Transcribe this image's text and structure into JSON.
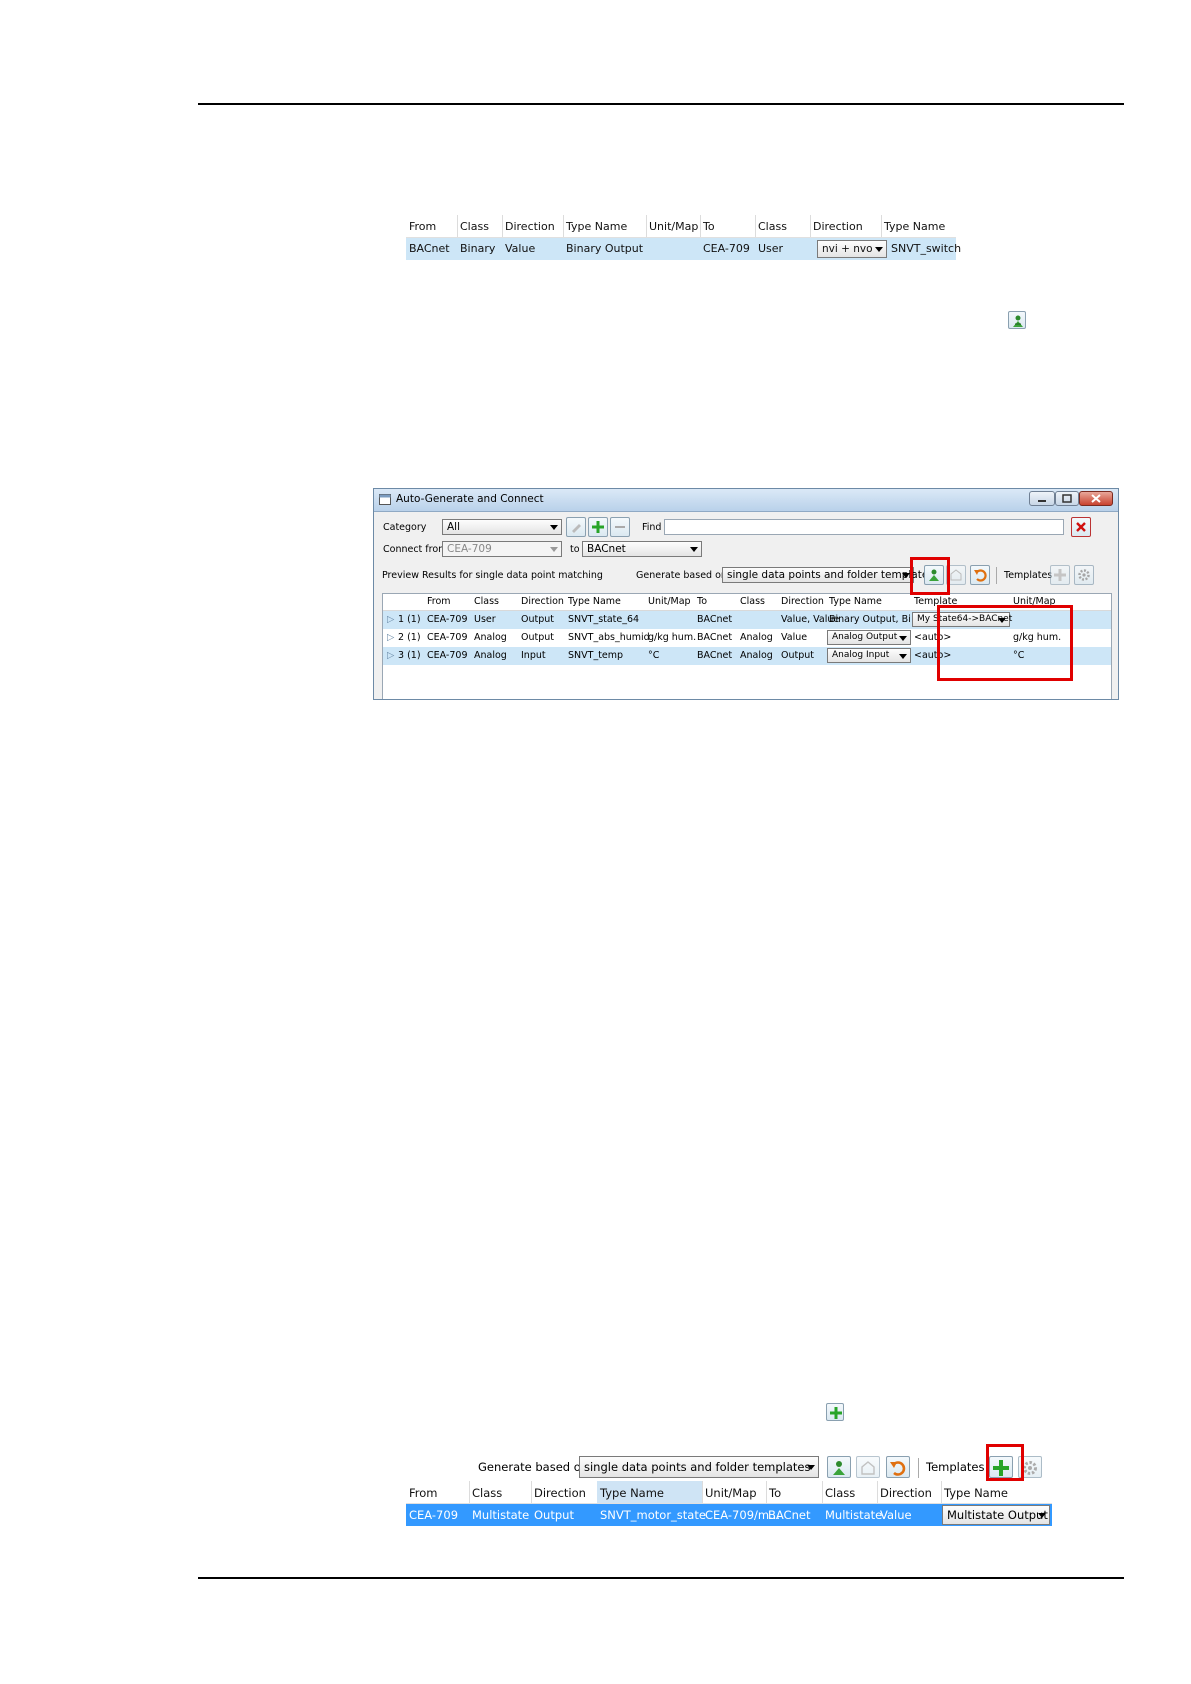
{
  "table1": {
    "headers": [
      "From",
      "Class",
      "Direction",
      "Type Name",
      "Unit/Map",
      "To",
      "Class",
      "Direction",
      "Type Name"
    ],
    "row": {
      "from": "BACnet",
      "class": "Binary",
      "direction": "Value",
      "type_name": "Binary Output",
      "unit_map": "",
      "to": "CEA-709",
      "class2": "User",
      "direction2": "nvi + nvo",
      "type_name2": "SNVT_switch"
    }
  },
  "standalone_icons": {
    "generate_icon": "connect-generate-icon",
    "add_icon": "green-plus-icon"
  },
  "dialog": {
    "title": "Auto-Generate and Connect",
    "category_label": "Category",
    "category_value": "All",
    "find_label": "Find",
    "find_value": "",
    "connect_from_label": "Connect from",
    "connect_from_value": "CEA-709",
    "to_label": "to",
    "to_value": "BACnet",
    "preview_label": "Preview Results for single data point matching",
    "generate_label": "Generate based on",
    "generate_value": "single data points and folder templates",
    "templates_label": "Templates",
    "columns": [
      "From",
      "Class",
      "Direction",
      "Type Name",
      "Unit/Map",
      "To",
      "Class",
      "Direction",
      "Type Name",
      "Template",
      "Unit/Map"
    ],
    "rows": [
      {
        "idx": "1 (1)",
        "from": "CEA-709",
        "class": "User",
        "direction": "Output",
        "type_name": "SNVT_state_64",
        "unit_map": "",
        "to": "BACnet",
        "class2": "",
        "direction2": "Value, Value",
        "type_name2": "Binary Output, Binary...",
        "template": "My State64->BACnet",
        "unit_map2": ""
      },
      {
        "idx": "2 (1)",
        "from": "CEA-709",
        "class": "Analog",
        "direction": "Output",
        "type_name": "SNVT_abs_humid",
        "unit_map": "g/kg hum.",
        "to": "BACnet",
        "class2": "Analog",
        "direction2": "Value",
        "type_name2": "Analog Output",
        "template": "<auto>",
        "unit_map2": "g/kg hum."
      },
      {
        "idx": "3 (1)",
        "from": "CEA-709",
        "class": "Analog",
        "direction": "Input",
        "type_name": "SNVT_temp",
        "unit_map": "°C",
        "to": "BACnet",
        "class2": "Analog",
        "direction2": "Output",
        "type_name2": "Analog Input",
        "template": "<auto>",
        "unit_map2": "°C"
      }
    ]
  },
  "bottom": {
    "generate_label": "Generate based on",
    "generate_value": "single data points and folder templates",
    "templates_label": "Templates",
    "headers": [
      "From",
      "Class",
      "Direction",
      "Type Name",
      "Unit/Map",
      "To",
      "Class",
      "Direction",
      "Type Name"
    ],
    "row": {
      "from": "CEA-709",
      "class": "Multistate",
      "direction": "Output",
      "type_name": "SNVT_motor_state",
      "unit_map": "CEA-709/m...",
      "to": "BACnet",
      "class2": "Multistate",
      "direction2": "Value",
      "type_name2": "Multistate Output"
    }
  },
  "colors": {
    "highlight_red": "#e00000",
    "row_blue": "#cde6f7",
    "selected_blue": "#3399ff"
  }
}
